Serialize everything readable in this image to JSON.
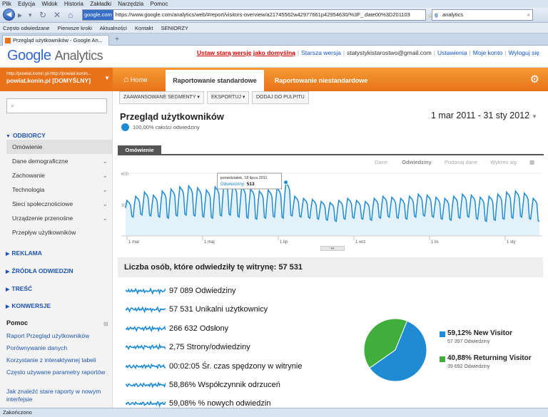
{
  "browser": {
    "menu": [
      "Plik",
      "Edycja",
      "Widok",
      "Historia",
      "Zakładki",
      "Narzędzia",
      "Pomoc"
    ],
    "url_domain": "google.com",
    "url": "https://www.google.com/analytics/web/#report/visitors-overview/a21745562w42977661p42954630/%3F_.date00%3D201103",
    "search_query": "analytics",
    "bookmarks": [
      "Często odwiedzane",
      "Pierwsze kroki",
      "Aktualności",
      "Kontakt",
      "SENIORZY"
    ],
    "tab_title": "Przegląd użytkowników - Google An...",
    "status": "Zakończono"
  },
  "ga_header": {
    "logo_google": "Google",
    "logo_analytics": "Analytics",
    "links": {
      "old_version": "Ustaw starą wersję jako domyślną",
      "older": "Starsza wersja",
      "email": "statystykistarostwo@gmail.com",
      "settings": "Ustawienia",
      "account": "Moje konto",
      "logout": "Wyloguj się"
    }
  },
  "nav": {
    "account_url": "http://powiat.konin.pl-http://powiat.konin...",
    "account_name": "powiat.konin.pl [DOMYŚLNY]",
    "home": "Home",
    "tab_standard": "Raportowanie standardowe",
    "tab_custom": "Raportowanie niestandardowe"
  },
  "sidebar": {
    "audience": "ODBIORCY",
    "items": [
      "Omówienie",
      "Dane demograficzne",
      "Zachowanie",
      "Technologia",
      "Sieci społecznościowe",
      "Urządzenie przenośne",
      "Przepływ użytkowników"
    ],
    "sections": [
      "REKLAMA",
      "ŹRÓDŁA ODWIEDZIN",
      "TREŚĆ",
      "KONWERSJE"
    ],
    "help_title": "Pomoc",
    "help_links": [
      "Raport Przegląd użytkowników",
      "Porównywanie danych",
      "Korzystanie z interaktywnej tabeli",
      "Często używane parametry raportów",
      "Jak znaleźć stare raporty w nowym interfejsie"
    ]
  },
  "toolbar": {
    "segments": "ZAAWANSOWANE SEGMENTY",
    "export": "EKSPORTUJ",
    "dashboard": "DODAJ DO PULPITU"
  },
  "report": {
    "title": "Przegląd użytkowników",
    "date_range": "1 mar 2011 - 31 sty 2012",
    "segment_text": "100,00% całości odwiedziny",
    "overview_tab": "Omówienie",
    "chart_controls": {
      "data_label": "Dane:",
      "data_value": "Odwiedziny",
      "compare": "Podanaj dane",
      "draw": "Wykres wg"
    },
    "visitors_heading": "Liczba osób, które odwiedziły tę witrynę: 57 531"
  },
  "chart_data": {
    "type": "line",
    "series": [
      {
        "name": "Odwiedziny",
        "color": "#1e8bd3"
      }
    ],
    "y_ticks": [
      600,
      300
    ],
    "ylim": [
      0,
      600
    ],
    "x_ticks": [
      "1 mar",
      "1 maj",
      "1 lip",
      "1 wrz",
      "1 lis",
      "1 sty"
    ],
    "tooltip": {
      "date": "poniedziałek, 18 lipca 2011",
      "label": "Odwiedziny",
      "value": 513
    },
    "weekly_peaks": [
      340,
      380,
      420,
      390,
      430,
      450,
      470,
      480,
      460,
      440,
      470,
      510,
      490,
      470,
      450,
      430,
      440,
      460,
      513,
      380,
      360,
      350,
      330,
      320,
      340,
      360,
      340,
      330,
      360,
      380,
      370,
      360,
      380,
      400,
      390,
      370,
      360,
      380,
      400,
      390,
      370,
      380,
      400,
      420,
      430,
      410,
      360
    ],
    "weekly_lows": [
      180,
      200,
      190,
      180,
      170,
      190,
      200,
      190,
      180,
      170,
      190,
      200,
      180,
      170,
      160,
      170,
      180,
      170,
      190,
      180,
      170,
      160,
      150,
      140,
      160,
      170,
      160,
      150,
      170,
      180,
      170,
      160,
      180,
      190,
      180,
      160,
      150,
      170,
      180,
      160,
      140,
      150,
      160,
      170,
      180,
      160,
      140
    ]
  },
  "metrics": [
    {
      "value": "97 089",
      "label": "Odwiedziny"
    },
    {
      "value": "57 531",
      "label": "Unikalni użytkownicy"
    },
    {
      "value": "266 632",
      "label": "Odsłony"
    },
    {
      "value": "2,75",
      "label": "Strony/odwiedziny"
    },
    {
      "value": "00:02:05",
      "label": "Śr. czas spędzony w witrynie"
    },
    {
      "value": "58,86%",
      "label": "Współczynnik odrzuceń"
    },
    {
      "value": "59,08%",
      "label": "% nowych odwiedzin"
    }
  ],
  "pie": {
    "slices": [
      {
        "pct": 59.12,
        "pct_label": "59,12%",
        "label": "New Visitor",
        "sub": "57 397 Odwiedziny",
        "color": "#1e8bd3"
      },
      {
        "pct": 40.88,
        "pct_label": "40,88%",
        "label": "Returning Visitor",
        "sub": "39 692 Odwiedziny",
        "color": "#3fae3a"
      }
    ]
  }
}
